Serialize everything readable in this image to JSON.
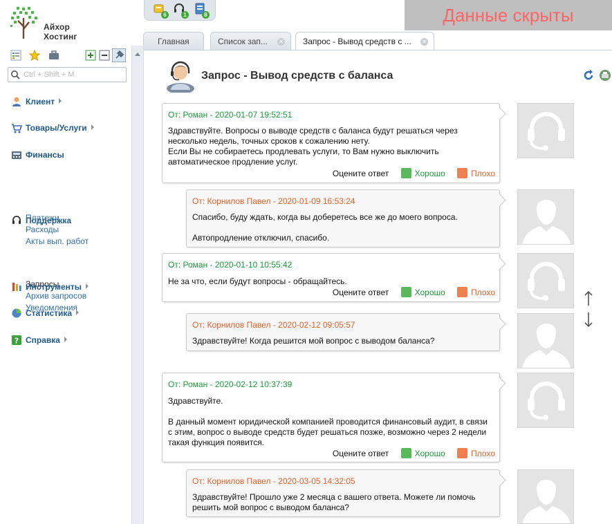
{
  "brand": {
    "line1": "Айхор",
    "line2": "Хостинг"
  },
  "quickbar": {
    "badges": [
      "6",
      "1",
      "8"
    ]
  },
  "hidden_banner": "Данные скрыты",
  "tabs": [
    {
      "label": "Главная",
      "closable": false,
      "active": false
    },
    {
      "label": "Список зап...",
      "closable": true,
      "active": false
    },
    {
      "label": "Запрос - Вывод средств с ...",
      "closable": true,
      "active": true
    }
  ],
  "sidebar": {
    "search_placeholder": "Ctrl + Shift + M",
    "sections": {
      "client": "Клиент",
      "goods": "Товары/Услуги",
      "finance": "Финансы",
      "support": "Поддержка",
      "tools": "Инструменты",
      "stats": "Статистика",
      "help": "Справка"
    },
    "finance_items": [
      "Платежи",
      "Расходы",
      "Акты вып. работ"
    ],
    "support_items": [
      "Запросы",
      "Архив запросов",
      "Уведомления"
    ]
  },
  "ticket": {
    "title": "Запрос - Вывод средств с баланса"
  },
  "rating": {
    "label": "Оцените ответ",
    "good": "Хорошо",
    "bad": "Плохо"
  },
  "messages": [
    {
      "header": "От: Роман - 2020-01-07 19:52:51",
      "lines": [
        "Здравствуйте. Вопросы о выводе средств с баланса будут решаться через",
        "несколько недель, точных сроков к сожалению нету.",
        "Если Вы не собираетесь продлевать услуги, то Вам нужно выключить",
        "автоматическое продление услуг."
      ]
    },
    {
      "header": "От: Корнилов Павел - 2020-01-09 16:53:24",
      "lines": [
        "Спасибо, буду ждать, когда вы доберетесь все же до моего вопроса.",
        "",
        "Автопродление отключил, спасибо."
      ]
    },
    {
      "header": "От: Роман - 2020-01-10 10:55:42",
      "lines": [
        "Не за что, если будут вопросы - обращайтесь."
      ]
    },
    {
      "header": "От: Корнилов Павел - 2020-02-12 09:05:57",
      "lines": [
        "Здравствуйте! Когда решится мой вопрос с выводом баланса?"
      ]
    },
    {
      "header": "От: Роман - 2020-02-12 10:37:39",
      "lines": [
        "Здравствуйте.",
        "",
        "В данный момент юридической компанией проводится финансовый аудит, в связи",
        "с этим, вопрос о выводе средств будет решаться позже, возможно через 2 недели",
        "такая функция появится."
      ]
    },
    {
      "header": "От: Корнилов Павел - 2020-03-05 14:32:05",
      "lines": [
        "Здравствуйте! Прошло уже 2 месяца с вашего ответа. Можете ли помочь",
        "решить мой вопрос с выводом баланса?"
      ]
    }
  ],
  "colors": {
    "support_header": "#1a9a3a",
    "client_header": "#e0622a",
    "menu_link": "#2f6fa8",
    "section_label": "#1e5a8e"
  },
  "icons": {
    "quickbar": [
      "ticket-icon",
      "headset-icon",
      "invoice-icon"
    ],
    "sidebar_tools": [
      "tree-view-icon",
      "star-icon",
      "briefcase-icon",
      "expand-icon",
      "collapse-icon",
      "pin-icon"
    ],
    "ticket": "support-operator-icon",
    "title_actions": [
      "refresh-icon",
      "print-icon"
    ],
    "rating": [
      "thumbs-up-icon",
      "thumbs-down-icon"
    ]
  }
}
